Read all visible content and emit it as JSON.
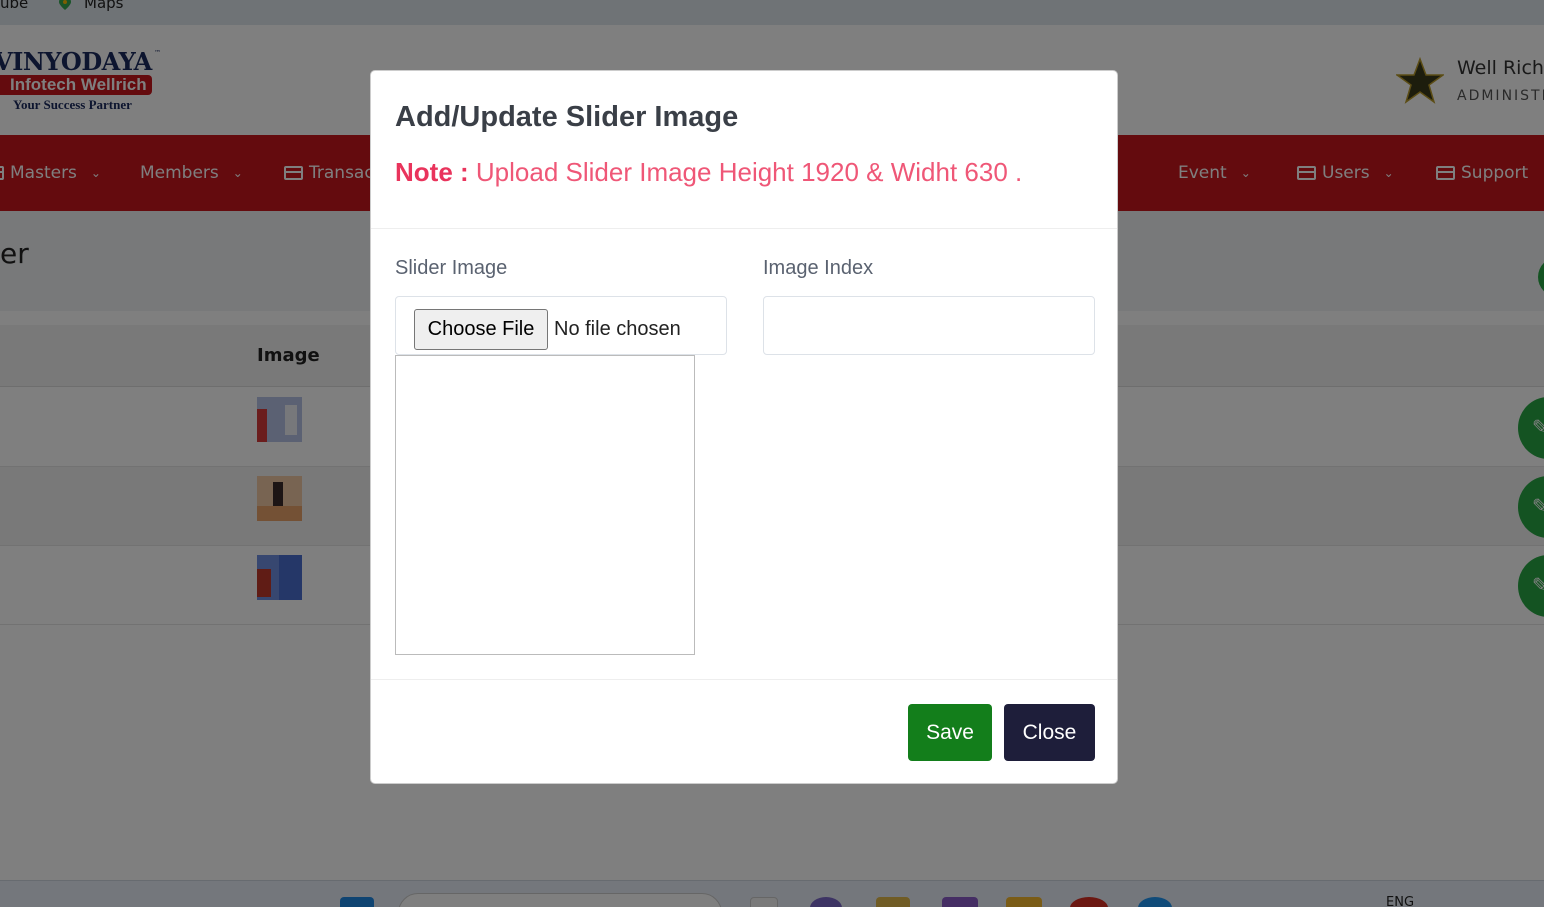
{
  "bookmarks": {
    "youtube": "ube",
    "maps": "Maps"
  },
  "brand": {
    "line1": "VINYODAYA",
    "tm": "™",
    "line2": "Infotech Wellrich",
    "tagline": "Your Success Partner"
  },
  "user": {
    "name": "Well Rich",
    "role": "ADMINISTR"
  },
  "nav": {
    "masters": "Masters",
    "members": "Members",
    "transactions": "Transac",
    "event": "Event",
    "users": "Users",
    "support": "Support"
  },
  "page": {
    "title": "er"
  },
  "table": {
    "header_image": "Image",
    "row_count": 3
  },
  "taskbar": {
    "lang": "ENG"
  },
  "modal": {
    "title": "Add/Update Slider Image",
    "note_label": "Note :",
    "note_text": "Upload Slider Image Height 1920 & Widht 630 .",
    "slider_image_label": "Slider Image",
    "choose_file": "Choose File",
    "no_file": "No file chosen",
    "image_index_label": "Image Index",
    "image_index_value": "",
    "save": "Save",
    "close": "Close"
  },
  "colors": {
    "brand_red": "#c8161d",
    "save_green": "#137e1b",
    "close_navy": "#1e1e3a",
    "note_pink": "#ef5777"
  }
}
